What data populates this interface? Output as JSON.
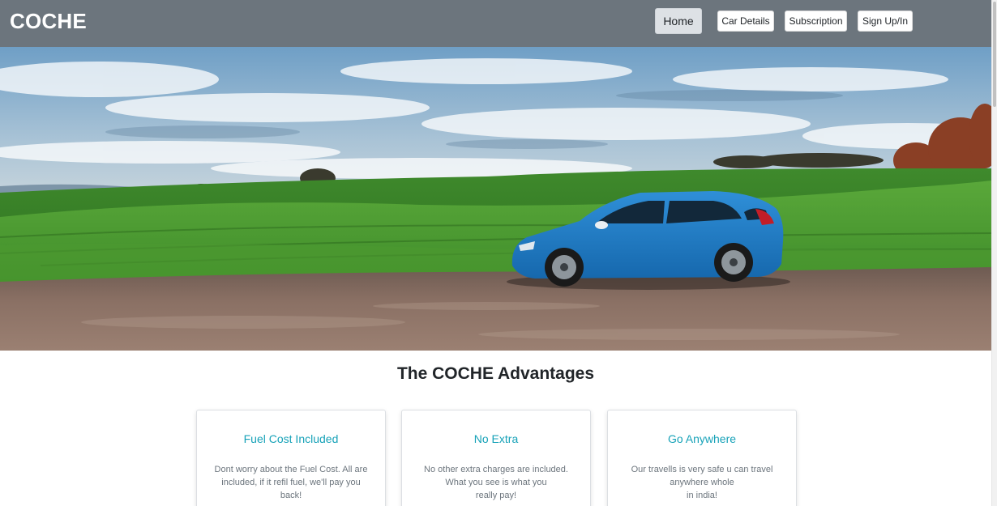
{
  "navbar": {
    "brand": "COCHE",
    "links": [
      {
        "label": "Home",
        "active": true
      },
      {
        "label": "Car Details",
        "active": false
      },
      {
        "label": "Subscription",
        "active": false
      },
      {
        "label": "Sign Up/In",
        "active": false
      }
    ],
    "background_color": "#6c757d"
  },
  "hero": {
    "image": "blue hatchback car parked on gravel road in front of green rolling fields under a cloudy sky"
  },
  "advantages": {
    "title": "The COCHE Advantages",
    "cards": [
      {
        "title": "Fuel Cost Included",
        "text_lines": [
          "Dont worry about the Fuel Cost. All are",
          "included, if it refil fuel, we'll pay you",
          "back!"
        ]
      },
      {
        "title": "No Extra",
        "text_lines": [
          "No other extra charges are included.",
          "What you see is what you",
          "really pay!"
        ]
      },
      {
        "title": "Go Anywhere",
        "text_lines": [
          "Our travells is very safe u can travel",
          "anywhere whole",
          "in india!"
        ]
      }
    ],
    "accent_color": "#17a2b8"
  }
}
